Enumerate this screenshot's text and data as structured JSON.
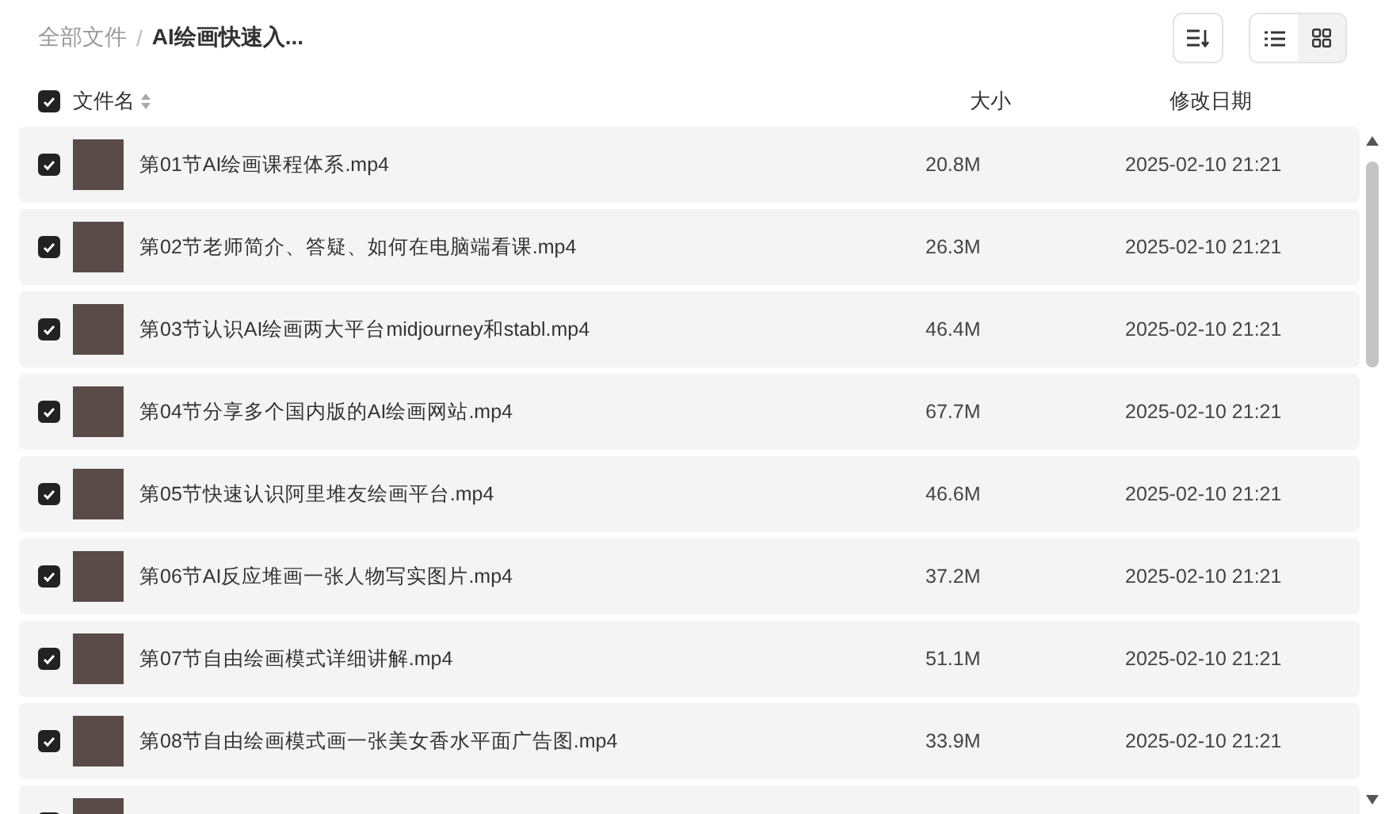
{
  "breadcrumb": [
    {
      "label": "全部文件",
      "current": false
    },
    {
      "label": "AI绘画快速入...",
      "current": true
    }
  ],
  "breadcrumb_separator": "/",
  "view_modes": [
    {
      "kind": "list",
      "selected": true
    },
    {
      "kind": "grid",
      "selected": false
    }
  ],
  "table": {
    "select_all": {
      "checked": true
    },
    "columns": [
      "文件名",
      "大小",
      "修改日期"
    ],
    "rows": [
      {
        "name": "第01节AI绘画课程体系.mp4",
        "size": "20.8M",
        "date": "2025-02-10 21:21",
        "checked": true
      },
      {
        "name": "第02节老师简介、答疑、如何在电脑端看课.mp4",
        "size": "26.3M",
        "date": "2025-02-10 21:21",
        "checked": true
      },
      {
        "name": "第03节认识AI绘画两大平台midjourney和stabl.mp4",
        "size": "46.4M",
        "date": "2025-02-10 21:21",
        "checked": true
      },
      {
        "name": "第04节分享多个国内版的AI绘画网站.mp4",
        "size": "67.7M",
        "date": "2025-02-10 21:21",
        "checked": true
      },
      {
        "name": "第05节快速认识阿里堆友绘画平台.mp4",
        "size": "46.6M",
        "date": "2025-02-10 21:21",
        "checked": true
      },
      {
        "name": "第06节AI反应堆画一张人物写实图片.mp4",
        "size": "37.2M",
        "date": "2025-02-10 21:21",
        "checked": true
      },
      {
        "name": "第07节自由绘画模式详细讲解.mp4",
        "size": "51.1M",
        "date": "2025-02-10 21:21",
        "checked": true
      },
      {
        "name": "第08节自由绘画模式画一张美女香水平面广告图.mp4",
        "size": "33.9M",
        "date": "2025-02-10 21:21",
        "checked": true
      },
      {
        "checked": true
      }
    ]
  }
}
